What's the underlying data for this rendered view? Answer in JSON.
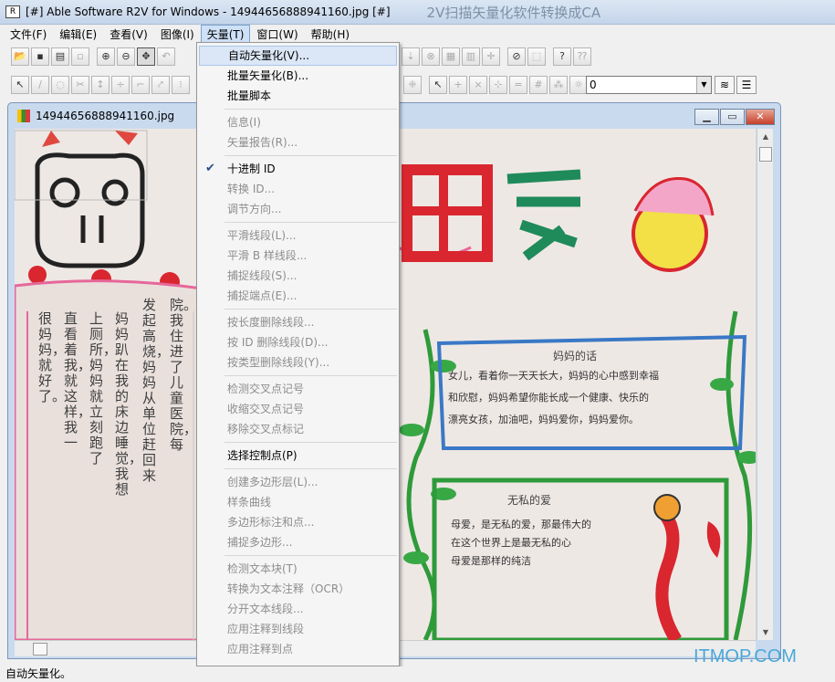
{
  "window": {
    "title": "[#] Able Software R2V for Windows - 14944656888941160.jpg [#]",
    "ghost_text": "2V扫描矢量化软件转换成CA"
  },
  "menubar": [
    {
      "label": "文件(F)"
    },
    {
      "label": "编辑(E)"
    },
    {
      "label": "查看(V)"
    },
    {
      "label": "图像(I)"
    },
    {
      "label": "矢量(T)",
      "active": true
    },
    {
      "label": "窗口(W)"
    },
    {
      "label": "帮助(H)"
    }
  ],
  "toolbar2": {
    "combo_value": "0"
  },
  "child_window": {
    "title": "14944656888941160.jpg"
  },
  "poster": {
    "heading": [
      "母",
      "爱"
    ],
    "left_poem_columns": [
      "院。我住进了儿童医院，每",
      "发起高烧，妈妈从单位赶回来",
      "妈妈趴在我的床边睡觉，我想",
      "上厕所，妈妈就立刻跑了",
      "直看着我，就这样，我一",
      "很妈妈，就好了。"
    ],
    "box1_title": "妈妈的话",
    "box1_lines": [
      "女儿，看着你一天天长大，妈妈的心中感到幸福",
      "和欣慰，妈妈希望你能长成一个健康、快乐的",
      "漂亮女孩，加油吧，妈妈爱你，妈妈爱你。"
    ],
    "box2_title": "无私的爱",
    "box2_lines": [
      "母爱，是无私的爱，那最伟大的",
      "在这个世界上是最无私的心",
      "母爱是那样的纯洁"
    ]
  },
  "dropdown": {
    "groups": [
      [
        {
          "label": "自动矢量化(V)...",
          "enabled": true,
          "highlight": true
        },
        {
          "label": "批量矢量化(B)...",
          "enabled": true
        },
        {
          "label": "批量脚本",
          "enabled": true
        }
      ],
      [
        {
          "label": "信息(I)",
          "enabled": false
        },
        {
          "label": "矢量报告(R)...",
          "enabled": false
        }
      ],
      [
        {
          "label": "十进制 ID",
          "enabled": true,
          "checked": true
        },
        {
          "label": "转换 ID...",
          "enabled": false
        },
        {
          "label": "调节方向...",
          "enabled": false
        }
      ],
      [
        {
          "label": "平滑线段(L)...",
          "enabled": false
        },
        {
          "label": "平滑 B 样线段...",
          "enabled": false
        },
        {
          "label": "捕捉线段(S)...",
          "enabled": false
        },
        {
          "label": "捕捉端点(E)...",
          "enabled": false
        }
      ],
      [
        {
          "label": "按长度删除线段...",
          "enabled": false
        },
        {
          "label": "按 ID 删除线段(D)...",
          "enabled": false
        },
        {
          "label": "按类型删除线段(Y)...",
          "enabled": false
        }
      ],
      [
        {
          "label": "检测交叉点记号",
          "enabled": false
        },
        {
          "label": "收缩交叉点记号",
          "enabled": false
        },
        {
          "label": "移除交叉点标记",
          "enabled": false
        }
      ],
      [
        {
          "label": "选择控制点(P)",
          "enabled": true
        }
      ],
      [
        {
          "label": "创建多边形层(L)...",
          "enabled": false
        },
        {
          "label": "样条曲线",
          "enabled": false
        },
        {
          "label": "多边形标注和点...",
          "enabled": false
        },
        {
          "label": "捕捉多边形...",
          "enabled": false
        }
      ],
      [
        {
          "label": "检测文本块(T)",
          "enabled": false
        },
        {
          "label": "转换为文本注释（OCR）",
          "enabled": false
        },
        {
          "label": "分开文本线段...",
          "enabled": false
        },
        {
          "label": "应用注释到线段",
          "enabled": false
        },
        {
          "label": "应用注释到点",
          "enabled": false
        }
      ]
    ]
  },
  "statusbar": {
    "text": "自动矢量化。"
  },
  "watermark": "ITMOP.COM",
  "colors": {
    "menu_highlight": "#dbe7f6",
    "heading_red": "#d9262f",
    "heading_green": "#1f8a5a"
  }
}
